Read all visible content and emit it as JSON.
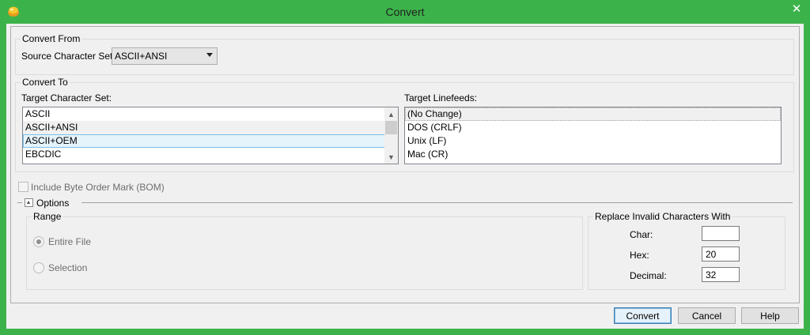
{
  "window": {
    "title": "Convert",
    "close_glyph": "✕"
  },
  "convert_from": {
    "title": "Convert From",
    "source_label": "Source Character Set:",
    "source_value": "ASCII+ANSI"
  },
  "convert_to": {
    "title": "Convert To",
    "target_charset_label": "Target Character Set:",
    "charsets": [
      "ASCII",
      "ASCII+ANSI",
      "ASCII+OEM",
      "EBCDIC"
    ],
    "selected_charset": "ASCII+OEM",
    "target_linefeeds_label": "Target Linefeeds:",
    "linefeeds": [
      "(No Change)",
      "DOS (CRLF)",
      "Unix (LF)",
      "Mac (CR)"
    ],
    "selected_linefeed": "(No Change)"
  },
  "bom": {
    "label": "Include Byte Order Mark (BOM)",
    "checked": false
  },
  "options": {
    "label": "Options",
    "range": {
      "title": "Range",
      "entire_file": "Entire File",
      "selection": "Selection",
      "selected": "Entire File"
    },
    "replace": {
      "title": "Replace Invalid Characters With",
      "char_label": "Char:",
      "char_value": "",
      "hex_label": "Hex:",
      "hex_value": "20",
      "decimal_label": "Decimal:",
      "decimal_value": "32"
    }
  },
  "buttons": {
    "convert": "Convert",
    "cancel": "Cancel",
    "help": "Help"
  },
  "icons": {
    "app": "app-logo-icon",
    "close": "close-icon",
    "dropdown": "chevron-down-icon",
    "scroll_up": "scroll-up-icon",
    "scroll_down": "scroll-down-icon",
    "expander": "collapse-icon"
  },
  "colors": {
    "titlebar": "#3cb34a",
    "selection": "#e5f3fb",
    "default_button": "#e5f1fb"
  }
}
